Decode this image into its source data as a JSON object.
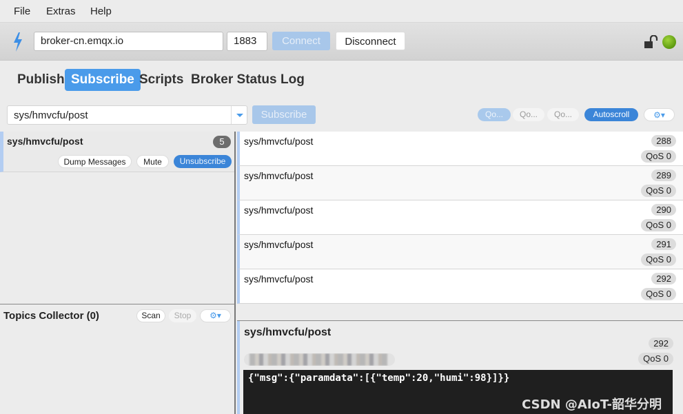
{
  "menu": {
    "items": [
      "File",
      "Extras",
      "Help"
    ]
  },
  "connection": {
    "broker": "broker-cn.emqx.io",
    "port": "1883",
    "connect_label": "Connect",
    "disconnect_label": "Disconnect",
    "lock_icon": "unlocked-padlock-icon",
    "status_icon": "connected-green-led",
    "status_color": "#6aab1a",
    "accent": "#4a9bea"
  },
  "tabs": [
    {
      "label": "Publish",
      "active": false
    },
    {
      "label": "Subscribe",
      "active": true
    },
    {
      "label": "Scripts",
      "active": false
    },
    {
      "label": "Broker Status",
      "active": false
    },
    {
      "label": "Log",
      "active": false
    }
  ],
  "subscribe_bar": {
    "topic_value": "sys/hmvcfu/post",
    "subscribe_label": "Subscribe",
    "qos_buttons": [
      "Qo...",
      "Qo...",
      "Qo..."
    ],
    "autoscroll_label": "Autoscroll",
    "options_icon": "gears-dropdown-icon"
  },
  "subscriptions": [
    {
      "topic": "sys/hmvcfu/post",
      "count": "5",
      "dump_label": "Dump Messages",
      "mute_label": "Mute",
      "unsubscribe_label": "Unsubscribe"
    }
  ],
  "topics_collector": {
    "title": "Topics Collector (0)",
    "scan_label": "Scan",
    "stop_label": "Stop"
  },
  "messages": [
    {
      "topic": "sys/hmvcfu/post",
      "number": "288",
      "qos": "QoS 0"
    },
    {
      "topic": "sys/hmvcfu/post",
      "number": "289",
      "qos": "QoS 0"
    },
    {
      "topic": "sys/hmvcfu/post",
      "number": "290",
      "qos": "QoS 0"
    },
    {
      "topic": "sys/hmvcfu/post",
      "number": "291",
      "qos": "QoS 0"
    },
    {
      "topic": "sys/hmvcfu/post",
      "number": "292",
      "qos": "QoS 0"
    }
  ],
  "detail": {
    "topic": "sys/hmvcfu/post",
    "number": "292",
    "qos": "QoS 0",
    "timestamp": "(blurred)",
    "payload": "{\"msg\":{\"paramdata\":[{\"temp\":20,\"humi\":98}]}}"
  },
  "watermark": "CSDN @AIoT-韶华分明"
}
